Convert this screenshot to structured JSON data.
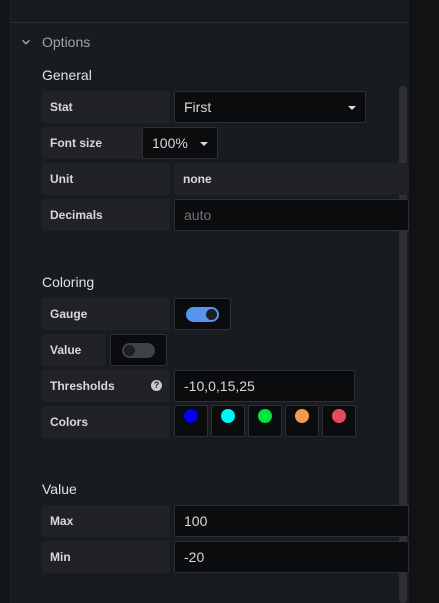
{
  "options": {
    "title": "Options",
    "icon": "chevron-down-icon"
  },
  "general": {
    "title": "General",
    "stat": {
      "label": "Stat",
      "value": "First"
    },
    "font_size": {
      "label": "Font size",
      "value": "100%"
    },
    "unit": {
      "label": "Unit",
      "value": "none"
    },
    "decimals": {
      "label": "Decimals",
      "placeholder": "auto"
    }
  },
  "coloring": {
    "title": "Coloring",
    "gauge": {
      "label": "Gauge",
      "enabled": true
    },
    "value": {
      "label": "Value",
      "enabled": false
    },
    "thresholds": {
      "label": "Thresholds",
      "help": "?",
      "value": "-10,0,15,25"
    },
    "colors": {
      "label": "Colors",
      "swatches": [
        "#0000f5",
        "#00f5f5",
        "#00e53e",
        "#f59a4a",
        "#e84a5f"
      ]
    }
  },
  "value_section": {
    "title": "Value",
    "max": {
      "label": "Max",
      "value": "100"
    },
    "min": {
      "label": "Min",
      "value": "-20"
    }
  },
  "colors": {
    "toggle_on": "#5794f2",
    "toggle_off": "#3f4246"
  }
}
